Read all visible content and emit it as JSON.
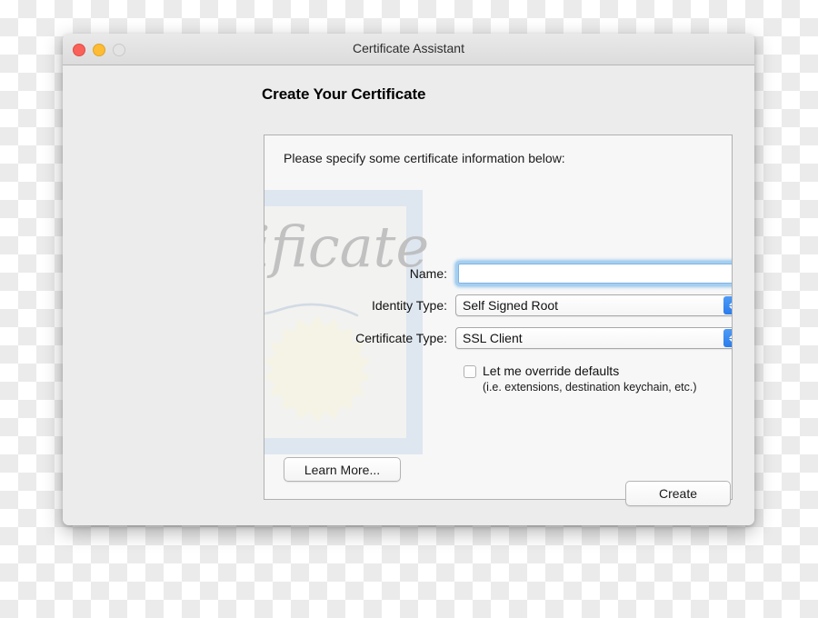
{
  "window": {
    "title": "Certificate Assistant",
    "traffic_lights": [
      {
        "name": "close",
        "color": "#fa6259"
      },
      {
        "name": "minimize",
        "color": "#fdbc33"
      },
      {
        "name": "zoom",
        "color": "#e4e4e4"
      }
    ]
  },
  "heading": "Create Your Certificate",
  "panel": {
    "intro": "Please specify some certificate information below:",
    "watermark": {
      "script_text": "Certificate",
      "border_color": "#cfdceb",
      "seal_color": "#f5f3e6"
    },
    "fields": [
      {
        "label": "Name:",
        "type": "text",
        "value": "",
        "placeholder": "",
        "focused": true
      },
      {
        "label": "Identity Type:",
        "type": "popup",
        "value": "Self Signed Root"
      },
      {
        "label": "Certificate Type:",
        "type": "popup",
        "value": "SSL Client"
      }
    ],
    "override": {
      "checked": false,
      "label": "Let me override defaults",
      "sub_label": "(i.e. extensions, destination keychain, etc.)"
    },
    "learn_more_label": "Learn More..."
  },
  "footer": {
    "create_label": "Create"
  },
  "colors": {
    "accent": "#2b7ced",
    "focus_ring": "#a5cff1",
    "window_bg": "#ececec",
    "panel_bg": "#f7f7f7"
  }
}
